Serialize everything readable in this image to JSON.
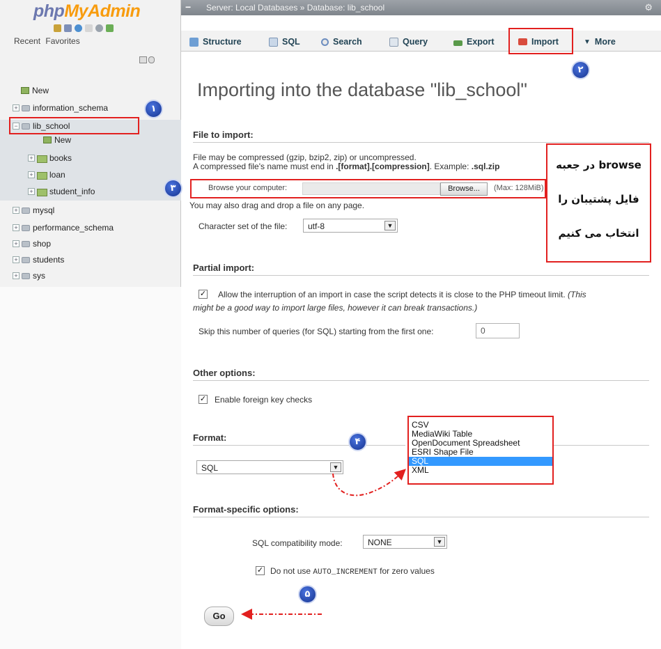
{
  "sidebar": {
    "logo_php": "php",
    "logo_my": "MyAdmin",
    "links": [
      "Recent",
      "Favorites"
    ],
    "tree": [
      {
        "label": "New",
        "kind": "new"
      },
      {
        "label": "information_schema",
        "kind": "db"
      },
      {
        "label": "lib_school",
        "kind": "db",
        "expanded": true
      },
      {
        "label": "New",
        "kind": "new"
      },
      {
        "label": "books",
        "kind": "table"
      },
      {
        "label": "loan",
        "kind": "table"
      },
      {
        "label": "student_info",
        "kind": "table"
      },
      {
        "label": "mysql",
        "kind": "db"
      },
      {
        "label": "performance_schema",
        "kind": "db"
      },
      {
        "label": "shop",
        "kind": "db"
      },
      {
        "label": "students",
        "kind": "db"
      },
      {
        "label": "sys",
        "kind": "db"
      }
    ]
  },
  "topbar": {
    "breadcrumb": "Server: Local Databases » Database: lib_school"
  },
  "tabs": [
    {
      "label": "Structure",
      "icon": "structure-icon"
    },
    {
      "label": "SQL",
      "icon": "sql-icon"
    },
    {
      "label": "Search",
      "icon": "search-icon"
    },
    {
      "label": "Query",
      "icon": "query-icon"
    },
    {
      "label": "Export",
      "icon": "export-icon"
    },
    {
      "label": "Import",
      "icon": "import-icon",
      "active": true
    },
    {
      "label": "More",
      "icon": "more-icon"
    }
  ],
  "main": {
    "title": "Importing into the database \"lib_school\"",
    "file_import": {
      "heading": "File to import:",
      "line1": "File may be compressed (gzip, bzip2, zip) or uncompressed.",
      "line2_pre": "A compressed file's name must end in ",
      "line2_bold": ".[format].[compression]",
      "line2_mid": ". Example: ",
      "line2_example": ".sql.zip",
      "browse_label": "Browse your computer:",
      "browse_button": "Browse...",
      "max_size": "(Max: 128MiB)",
      "drag_hint": "You may also drag and drop a file on any page.",
      "charset_label": "Character set of the file:",
      "charset_value": "utf-8"
    },
    "partial_import": {
      "heading": "Partial import:",
      "allow_interrupt_text": "Allow the interruption of an import in case the script detects it is close to the PHP timeout limit.",
      "allow_interrupt_note1": "(This",
      "allow_interrupt_note2": "might be a good way to import large files, however it can break transactions.)",
      "allow_interrupt_checked": true,
      "skip_label": "Skip this number of queries (for SQL) starting from the first one:",
      "skip_value": "0"
    },
    "other_options": {
      "heading": "Other options:",
      "foreign_key_label": "Enable foreign key checks",
      "foreign_key_checked": true
    },
    "format": {
      "heading": "Format:",
      "value": "SQL",
      "options": [
        "CSV",
        "MediaWiki Table",
        "OpenDocument Spreadsheet",
        "ESRI Shape File",
        "SQL",
        "XML"
      ],
      "selected": "SQL"
    },
    "format_specific": {
      "heading": "Format-specific options:",
      "compat_label": "SQL compatibility mode:",
      "compat_value": "NONE",
      "auto_inc_pre": "Do not use ",
      "auto_inc_code": "AUTO_INCREMENT",
      "auto_inc_post": " for zero values",
      "auto_inc_checked": true
    },
    "go_button": "Go"
  },
  "callout": {
    "line1": "در جعبه browse",
    "line2": "فایل پشتیبان را",
    "line3": "انتخاب می کنیم"
  },
  "badges": [
    "۱",
    "۲",
    "۳",
    "۴",
    "۵"
  ],
  "colors": {
    "highlight_red": "#e2201f",
    "badge_blue": "#1e3fa8",
    "selection_blue": "#3399ff",
    "logo_blue": "#6c78af",
    "logo_orange": "#f89c0e"
  }
}
